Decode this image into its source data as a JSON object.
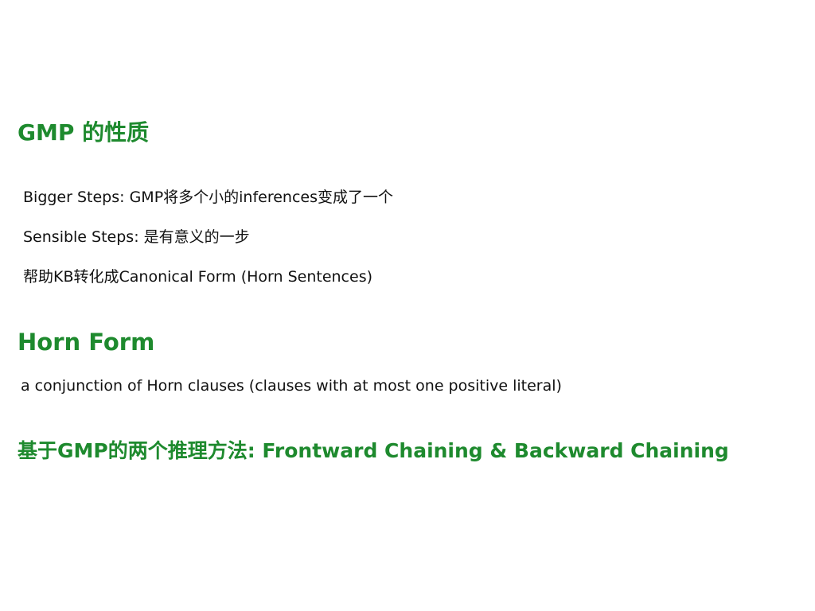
{
  "slide": {
    "sections": [
      {
        "heading": "GMP 的性质",
        "lines": [
          "Bigger Steps: GMP将多个小的inferences变成了一个",
          "Sensible Steps: 是有意义的一步",
          "帮助KB转化成Canonical Form (Horn Sentences)"
        ]
      },
      {
        "heading": "Horn Form",
        "lines": [
          "a conjunction of Horn clauses (clauses with at most one positive literal)"
        ]
      },
      {
        "heading": "基于GMP的两个推理方法: Frontward Chaining & Backward Chaining",
        "lines": []
      }
    ],
    "colors": {
      "heading": "#1e8a2e",
      "body": "#111111",
      "background": "#ffffff"
    }
  }
}
